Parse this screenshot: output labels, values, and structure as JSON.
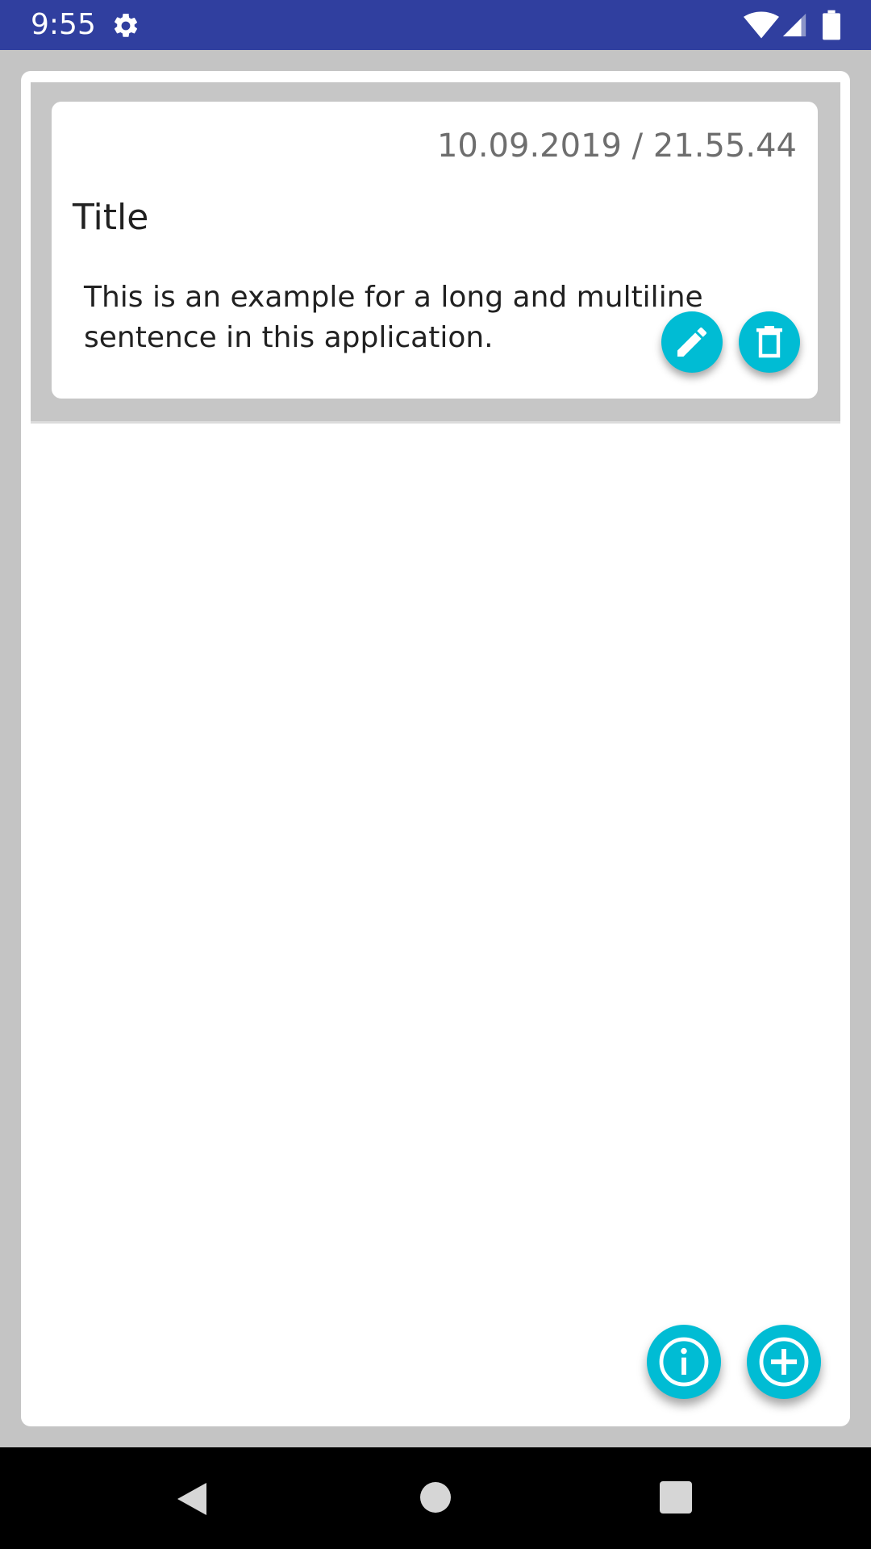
{
  "status_bar": {
    "time": "9:55",
    "icons": [
      "gear-icon",
      "wifi-icon",
      "signal-icon",
      "battery-icon"
    ],
    "color": "#303f9f"
  },
  "note": {
    "date": "10.09.2019 / 21.55.44",
    "title": "Title",
    "body": "This is an example for a long and multiline sentence in this application.",
    "actions": [
      "edit-icon",
      "delete-icon"
    ]
  },
  "fabs": [
    "info-icon",
    "add-icon"
  ],
  "accent_color": "#00bcd4",
  "nav_bar": {
    "buttons": [
      "back-icon",
      "home-icon",
      "recents-icon"
    ]
  }
}
